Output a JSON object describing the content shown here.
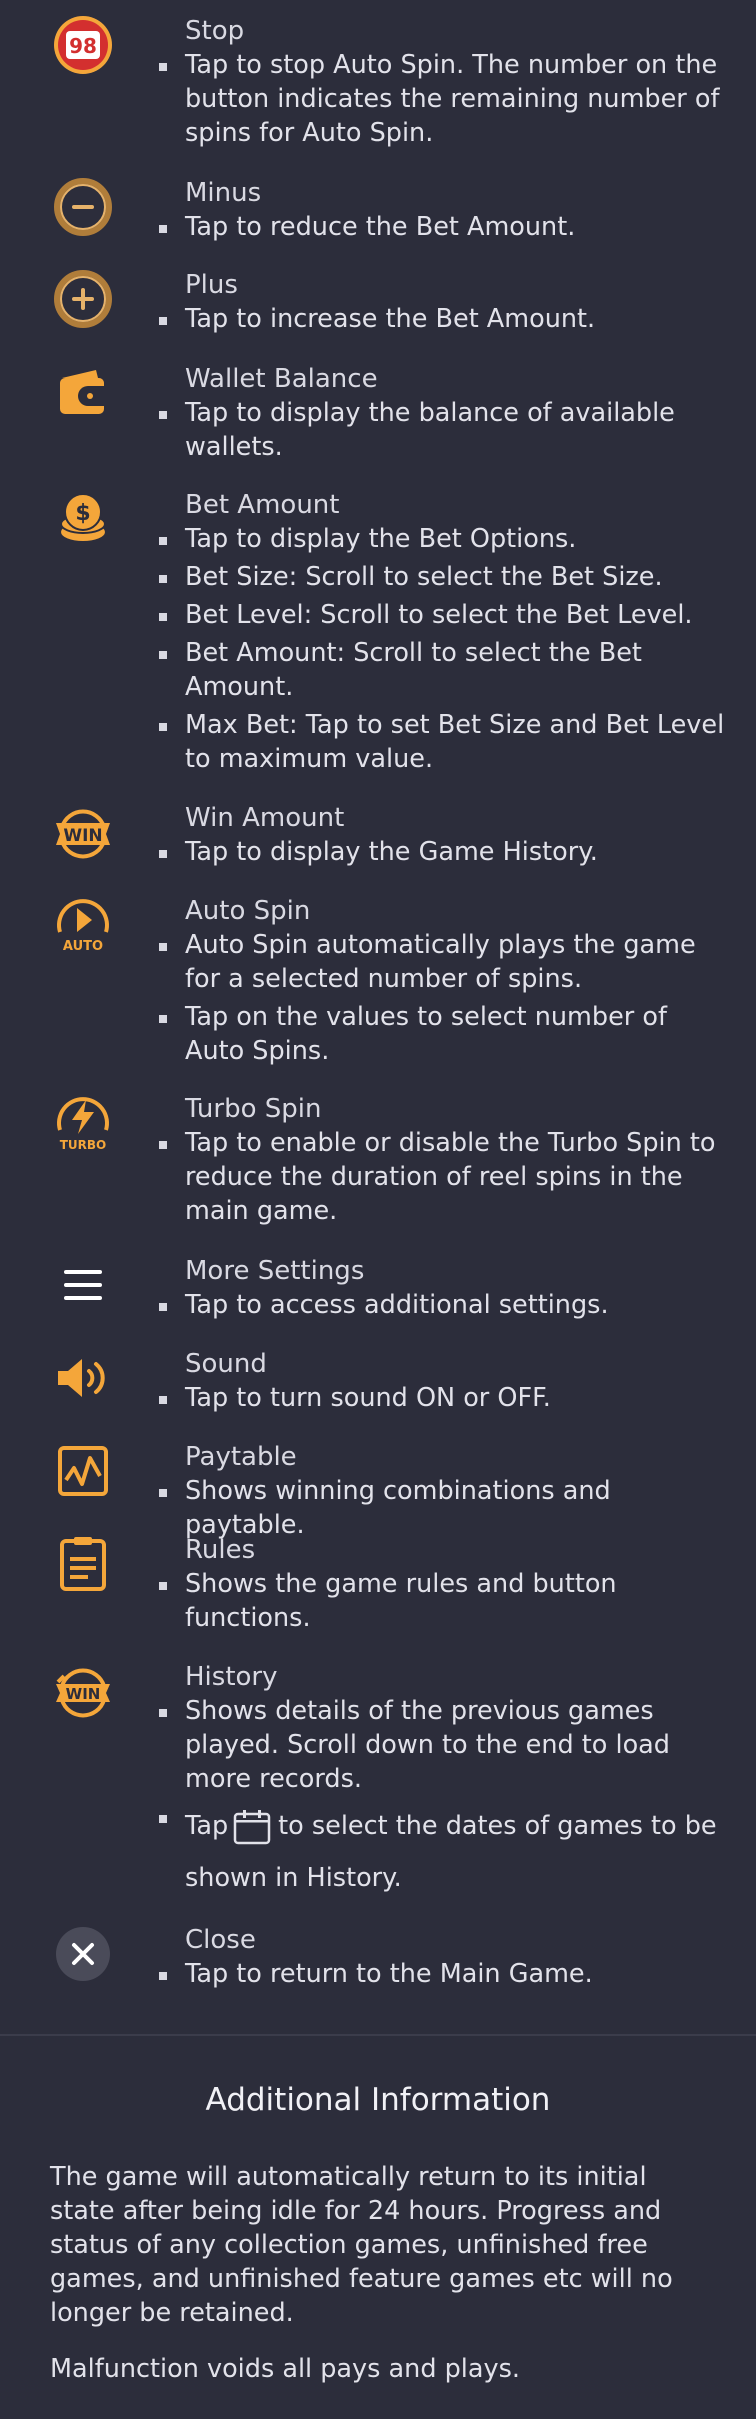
{
  "items": [
    {
      "icon": "stop-98-icon",
      "badge": "98",
      "title": "Stop",
      "bullets": [
        "Tap to stop Auto Spin. The number on the button indicates the remaining number of spins for Auto Spin."
      ]
    },
    {
      "icon": "minus-icon",
      "title": "Minus",
      "bullets": [
        "Tap to reduce the Bet Amount."
      ]
    },
    {
      "icon": "plus-icon",
      "title": "Plus",
      "bullets": [
        "Tap to increase the Bet Amount."
      ]
    },
    {
      "icon": "wallet-icon",
      "title": "Wallet Balance",
      "bullets": [
        "Tap to display the balance of available wallets."
      ]
    },
    {
      "icon": "coins-icon",
      "title": "Bet Amount",
      "bullets": [
        "Tap to display the Bet Options.",
        "Bet Size: Scroll to select the Bet Size.",
        "Bet Level: Scroll to select the Bet Level.",
        "Bet Amount: Scroll to select the Bet Amount.",
        "Max Bet: Tap to set Bet Size and Bet Level to maximum value."
      ]
    },
    {
      "icon": "win-badge-icon",
      "badge": "WIN",
      "title": "Win Amount",
      "bullets": [
        "Tap to display the Game History."
      ]
    },
    {
      "icon": "auto-spin-icon",
      "badge": "AUTO",
      "title": "Auto Spin",
      "bullets": [
        "Auto Spin automatically plays the game for a selected number of spins.",
        "Tap on the values to select number of Auto Spins."
      ]
    },
    {
      "icon": "turbo-icon",
      "badge": "TURBO",
      "title": "Turbo Spin",
      "bullets": [
        "Tap to enable or disable the Turbo Spin to reduce the duration of reel spins in the main game."
      ]
    },
    {
      "icon": "menu-icon",
      "title": "More Settings",
      "bullets": [
        "Tap to access additional settings."
      ]
    },
    {
      "icon": "speaker-icon",
      "title": "Sound",
      "bullets": [
        "Tap to turn sound ON or OFF."
      ]
    },
    {
      "icon": "paytable-chart-icon",
      "title": "Paytable",
      "bullets": [
        "Shows winning combinations and paytable."
      ]
    },
    {
      "icon": "rules-doc-icon",
      "title": "Rules",
      "bullets": [
        "Shows the game rules and button functions."
      ]
    },
    {
      "icon": "history-win-icon",
      "badge": "WIN",
      "title": "History",
      "bullets": [
        "Shows details of the previous games played. Scroll down to the end to load more records."
      ],
      "calendar_bullet": {
        "before": "Tap",
        "after": "to select the dates of games to be shown in History."
      }
    },
    {
      "icon": "close-icon",
      "title": "Close",
      "bullets": [
        "Tap to return to the Main Game."
      ]
    }
  ],
  "additional": {
    "title": "Additional Information",
    "paragraphs": [
      "The game will automatically return to its initial state after being idle for 24 hours. Progress and status of any collection games, unfinished free games, and unfinished feature games etc will no longer be retained.",
      "Malfunction voids all pays and plays."
    ]
  },
  "colors": {
    "background": "#2c2d3b",
    "accent": "#f4a63a",
    "icon_red": "#d32f2f",
    "text": "#e2e2ea"
  }
}
